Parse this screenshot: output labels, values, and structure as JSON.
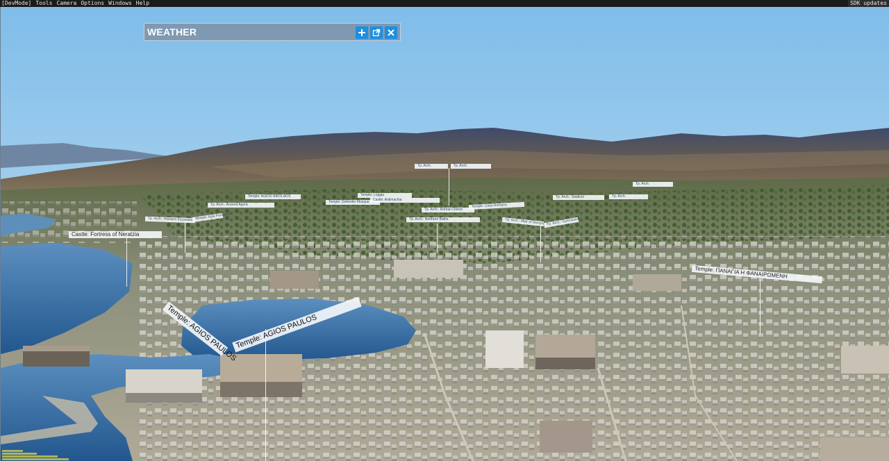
{
  "menubar": {
    "items": [
      "[DevMode]",
      "Tools",
      "Camera",
      "Options",
      "Windows",
      "Help"
    ],
    "right": "SDK updates"
  },
  "weather_panel": {
    "title": "WEATHER",
    "buttons": [
      "add-icon",
      "popout-icon",
      "close-icon"
    ],
    "accent": "#1e8fe0"
  },
  "poi_labels": {
    "agios_a": "Temple: AGIOS PAULOS",
    "agios_b": "Temple: AGIOS PAULOS",
    "panagia": "Temple: ΠΑΝΑΓΙΑ Η ΦΑΝΑΙΡΩΜΕΝΗ",
    "castle": "Castle: Fortress of Neratzia",
    "l1": "Tp. Arch.: Ancient Agora",
    "l2": "Temple: AGIOS NIKOLAOS",
    "l3": "Temple: Defender Mosque",
    "l4": "Temple: Loggia",
    "l5": "Tp. Arch.: Northern Baths",
    "l6": "Tp. Arch.: Roman Odeon",
    "l7": "Castle: Antimachia",
    "l8": "Tp. Arch.",
    "l9": "Tp. Arch.",
    "l10": "Temple: Casa Romana",
    "l11": "Tp. Arch.: Altar of Dionysus",
    "l12": "Tp. Arch.: Gymnasium",
    "l13": "Tp. Arch.: Stadium",
    "l14": "Tp. Arch.",
    "l15": "Tp. Arch.",
    "l16": "Tp. Arch.: Western Excavations",
    "l17": "Temple: Agia Paraskevi"
  },
  "colors": {
    "sky_top": "#8ec3ea",
    "sky_horizon": "#cfe4f4",
    "sea": "#2f6fa8",
    "mountain": "#6a5a52"
  }
}
